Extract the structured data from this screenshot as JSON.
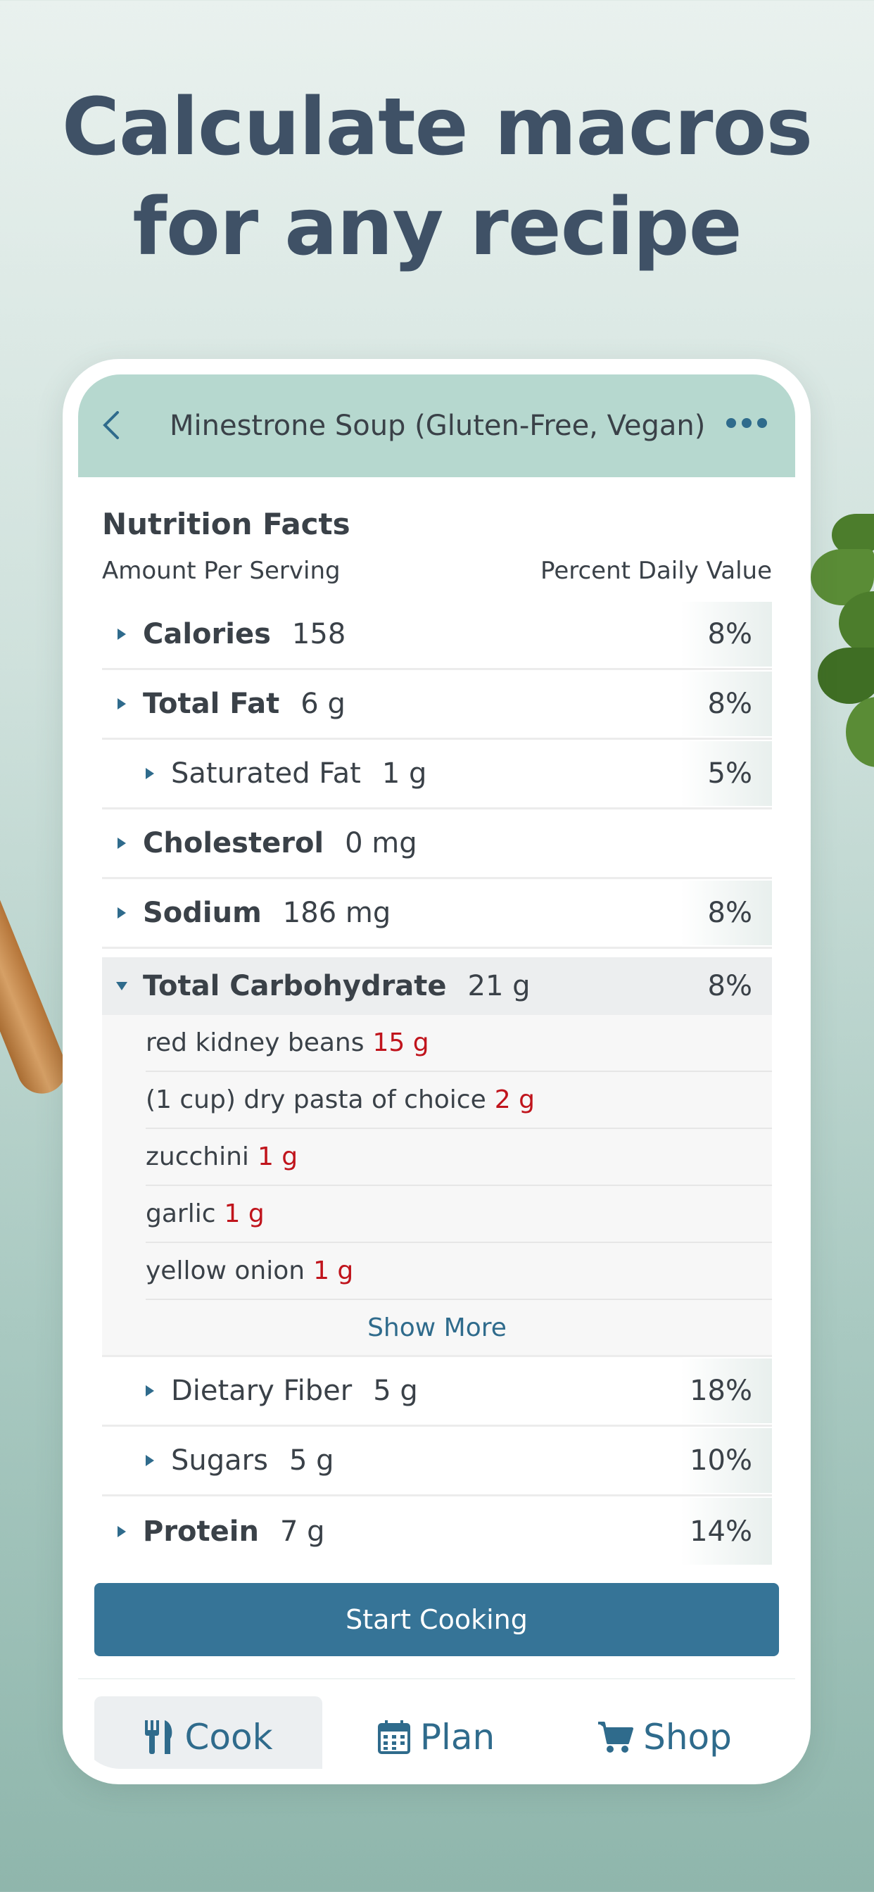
{
  "headline": {
    "line1": "Calculate macros",
    "line2": "for any recipe"
  },
  "nav": {
    "title": "Minestrone Soup (Gluten-Free, Vegan)",
    "back_icon": "chevron-left-icon",
    "more_icon": "more-dots-icon"
  },
  "nutrition": {
    "title": "Nutrition Facts",
    "amount_label": "Amount Per Serving",
    "percent_label": "Percent Daily Value",
    "rows": [
      {
        "name": "Calories",
        "value": "158",
        "percent": "8%"
      },
      {
        "name": "Total Fat",
        "value": "6 g",
        "percent": "8%"
      },
      {
        "name": "Saturated Fat",
        "value": "1 g",
        "percent": "5%"
      },
      {
        "name": "Cholesterol",
        "value": "0 mg",
        "percent": ""
      },
      {
        "name": "Sodium",
        "value": "186 mg",
        "percent": "8%"
      },
      {
        "name": "Total Carbohydrate",
        "value": "21 g",
        "percent": "8%"
      },
      {
        "name": "Dietary Fiber",
        "value": "5 g",
        "percent": "18%"
      },
      {
        "name": "Sugars",
        "value": "5 g",
        "percent": "10%"
      },
      {
        "name": "Protein",
        "value": "7 g",
        "percent": "14%"
      }
    ],
    "carb_ingredients": [
      {
        "name": "red kidney beans",
        "amount": "15 g"
      },
      {
        "name": "(1 cup) dry pasta of choice",
        "amount": "2 g"
      },
      {
        "name": "zucchini",
        "amount": "1 g"
      },
      {
        "name": "garlic",
        "amount": "1 g"
      },
      {
        "name": "yellow onion",
        "amount": "1 g"
      }
    ],
    "show_more": "Show More"
  },
  "cta": {
    "label": "Start Cooking"
  },
  "tabs": [
    {
      "label": "Cook",
      "icon": "utensils-icon",
      "active": true
    },
    {
      "label": "Plan",
      "icon": "calendar-icon",
      "active": false
    },
    {
      "label": "Shop",
      "icon": "cart-icon",
      "active": false
    }
  ],
  "colors": {
    "headline": "#3f5166",
    "nav_bg": "#b6d8cf",
    "accent": "#2f6b8c",
    "cta_bg": "#367497",
    "ingredient_amount": "#c0141c"
  }
}
